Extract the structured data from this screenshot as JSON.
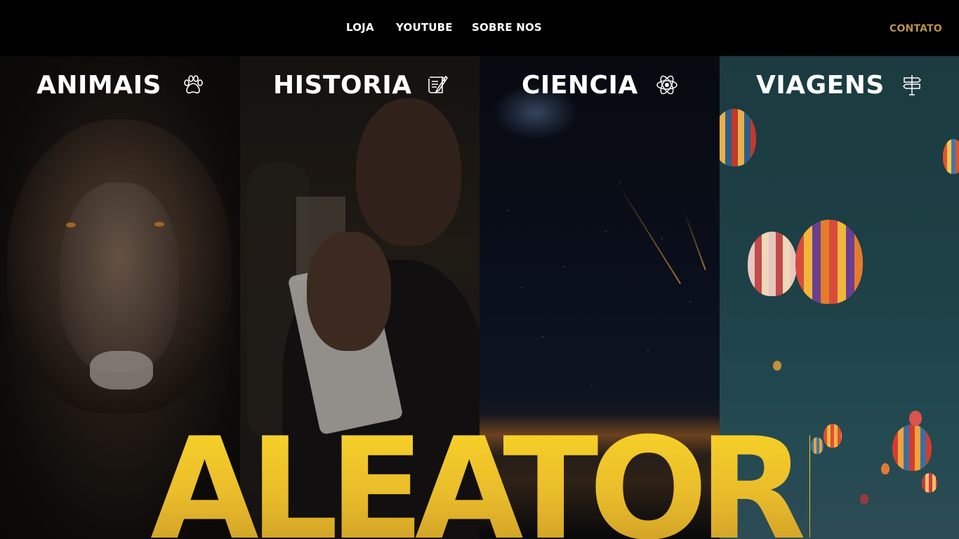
{
  "nav": {
    "loja": "LOJA",
    "youtube": "YOUTUBE",
    "sobre": "SOBRE NOS",
    "contato": "CONTATO"
  },
  "colors": {
    "accent_gold": "#b8934a",
    "hero_yellow": "#f6c928",
    "background": "#000000"
  },
  "panels": [
    {
      "title": "ANIMAIS",
      "icon": "paw-icon"
    },
    {
      "title": "HISTORIA",
      "icon": "scroll-quill-icon"
    },
    {
      "title": "CIENCIA",
      "icon": "atom-icon"
    },
    {
      "title": "VIAGENS",
      "icon": "signpost-icon"
    }
  ],
  "hero": {
    "word": "ALEATORIO"
  }
}
